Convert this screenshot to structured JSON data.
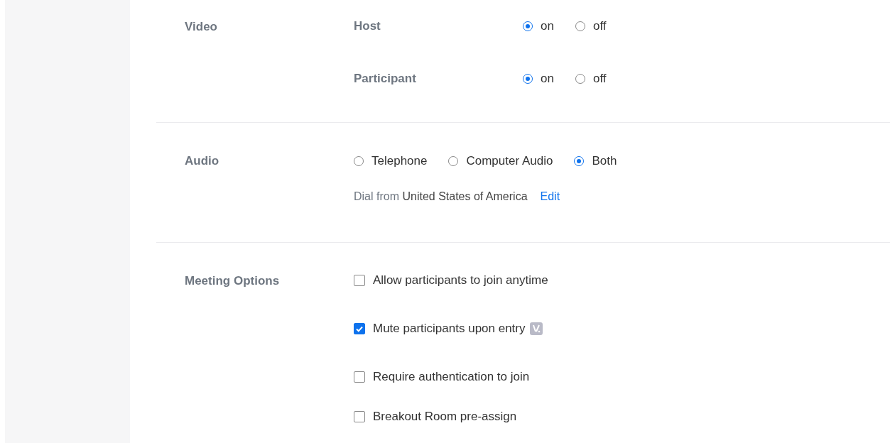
{
  "video": {
    "label": "Video",
    "rows": [
      {
        "name": "Host",
        "options": [
          {
            "label": "on",
            "selected": true
          },
          {
            "label": "off",
            "selected": false
          }
        ]
      },
      {
        "name": "Participant",
        "options": [
          {
            "label": "on",
            "selected": true
          },
          {
            "label": "off",
            "selected": false
          }
        ]
      }
    ]
  },
  "audio": {
    "label": "Audio",
    "options": [
      {
        "label": "Telephone",
        "selected": false
      },
      {
        "label": "Computer Audio",
        "selected": false
      },
      {
        "label": "Both",
        "selected": true
      }
    ],
    "dial_text": "Dial from **United States of America**",
    "edit_link": "Edit"
  },
  "meeting_options": {
    "label": "Meeting Options",
    "items": [
      {
        "label": "Allow participants to join anytime",
        "checked": false,
        "badge": false
      },
      {
        "label": "Mute participants upon entry",
        "checked": true,
        "badge": true
      },
      {
        "label": "Require authentication to join",
        "checked": false,
        "badge": false
      },
      {
        "label": "Breakout Room pre-assign",
        "checked": false,
        "badge": false
      }
    ]
  }
}
